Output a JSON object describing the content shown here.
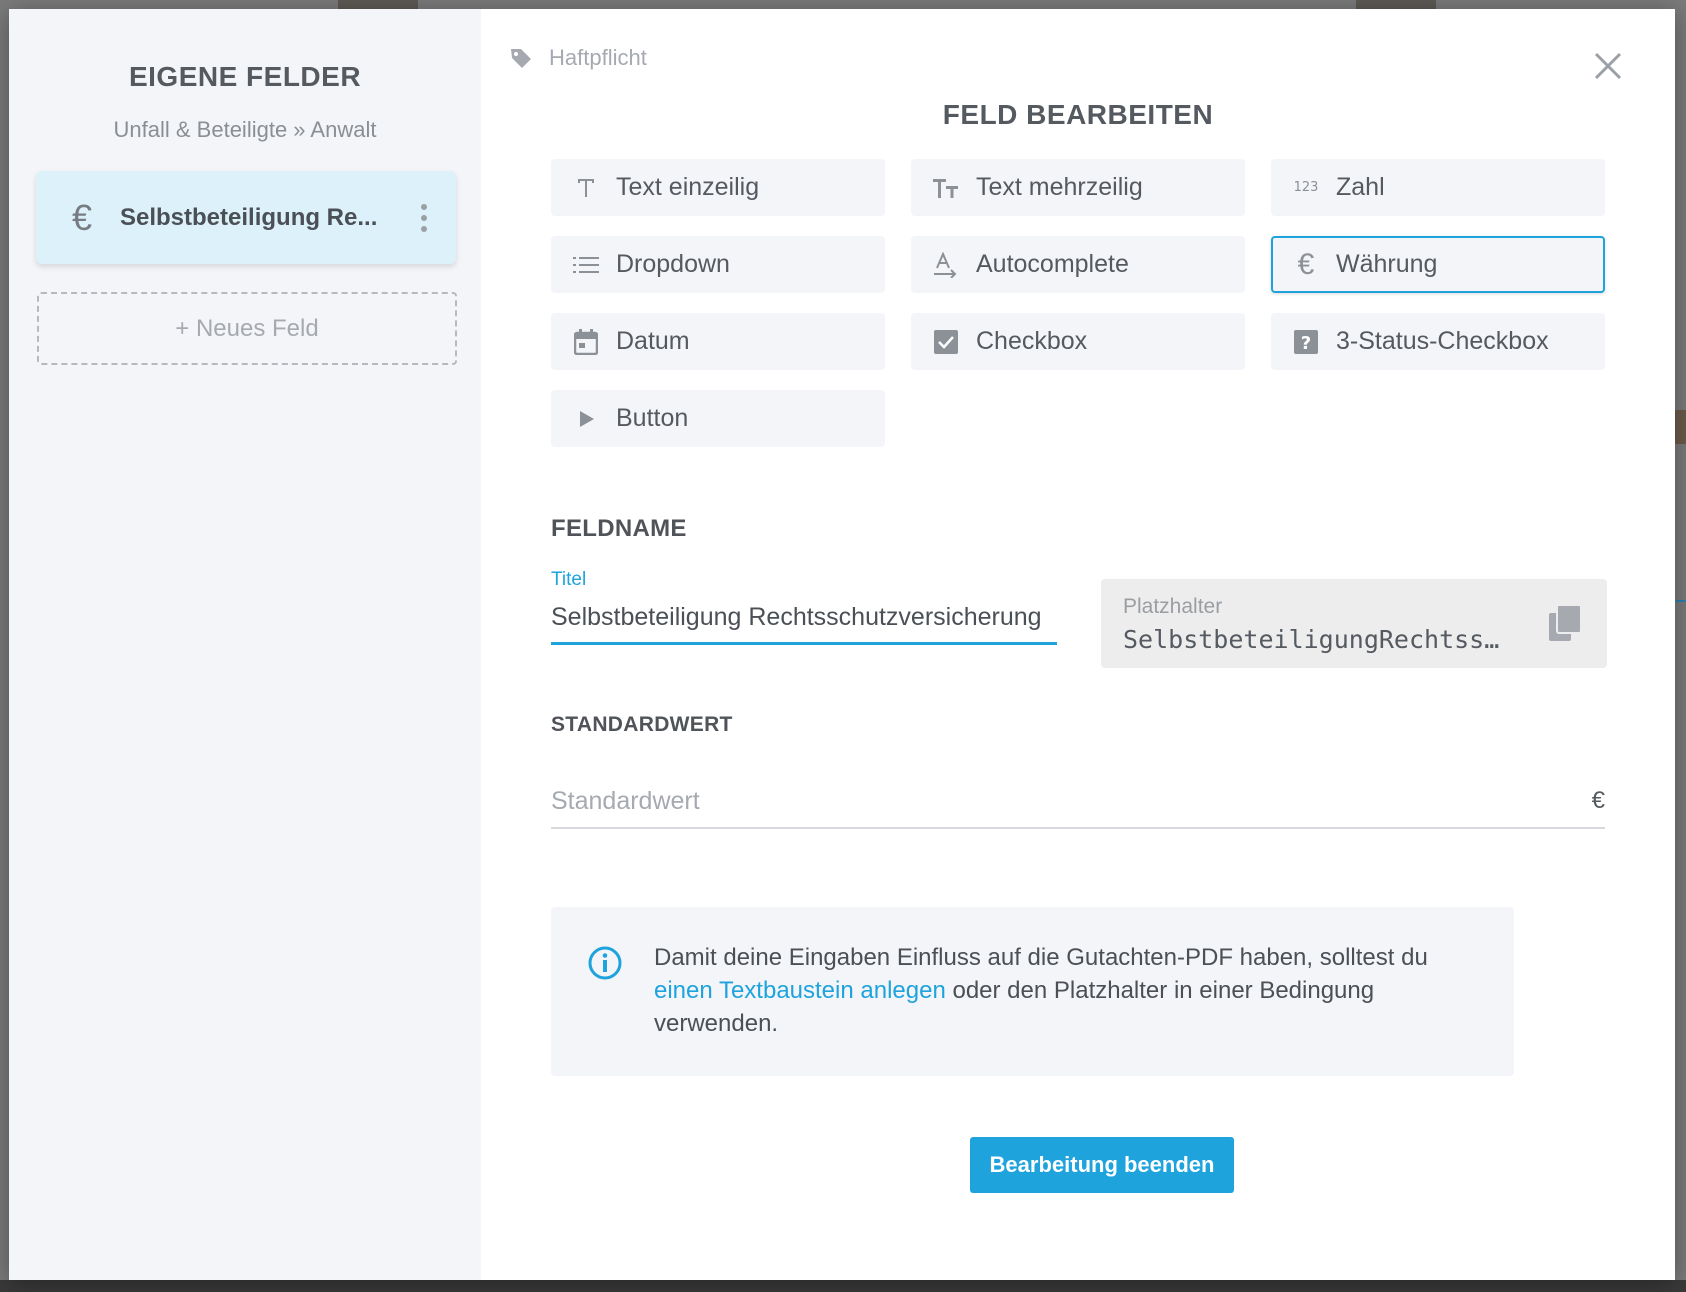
{
  "sidebar": {
    "title": "EIGENE FELDER",
    "breadcrumb": "Unfall & Beteiligte » Anwalt",
    "fields": [
      {
        "icon": "euro-icon",
        "label": "Selbstbeteiligung Re..."
      }
    ],
    "new_field_label": "+ Neues Feld"
  },
  "header": {
    "tag_label": "Haftpflicht",
    "title": "FELD BEARBEITEN"
  },
  "field_types": [
    {
      "label": "Text einzeilig",
      "icon": "text-icon",
      "selected": false
    },
    {
      "label": "Text mehrzeilig",
      "icon": "text-size-icon",
      "selected": false
    },
    {
      "label": "Zahl",
      "icon": "numeric-icon",
      "selected": false
    },
    {
      "label": "Dropdown",
      "icon": "list-icon",
      "selected": false
    },
    {
      "label": "Autocomplete",
      "icon": "autocomplete-icon",
      "selected": false
    },
    {
      "label": "Währung",
      "icon": "euro-icon",
      "selected": true
    },
    {
      "label": "Datum",
      "icon": "calendar-icon",
      "selected": false
    },
    {
      "label": "Checkbox",
      "icon": "checkbox-icon",
      "selected": false
    },
    {
      "label": "3-Status-Checkbox",
      "icon": "question-box-icon",
      "selected": false
    },
    {
      "label": "Button",
      "icon": "play-icon",
      "selected": false
    }
  ],
  "feldname": {
    "section_label": "FELDNAME",
    "title_label": "Titel",
    "title_value": "Selbstbeteiligung Rechtsschutzversicherung",
    "placeholder_label": "Platzhalter",
    "placeholder_value": "SelbstbeteiligungRechtss…"
  },
  "standardwert": {
    "section_label": "STANDARDWERT",
    "placeholder": "Standardwert",
    "unit": "€"
  },
  "info": {
    "text_before": "Damit deine Eingaben Einfluss auf die Gutachten-PDF haben, solltest du ",
    "link_text": "einen Textbaustein anlegen",
    "text_after": " oder den Platzhalter in einer Bedingung verwenden."
  },
  "actions": {
    "done_label": "Bearbeitung beenden"
  },
  "colors": {
    "accent": "#1ea3dd",
    "selected_card_bg": "#dcf1f9",
    "sidebar_bg": "#f4f5f8"
  }
}
